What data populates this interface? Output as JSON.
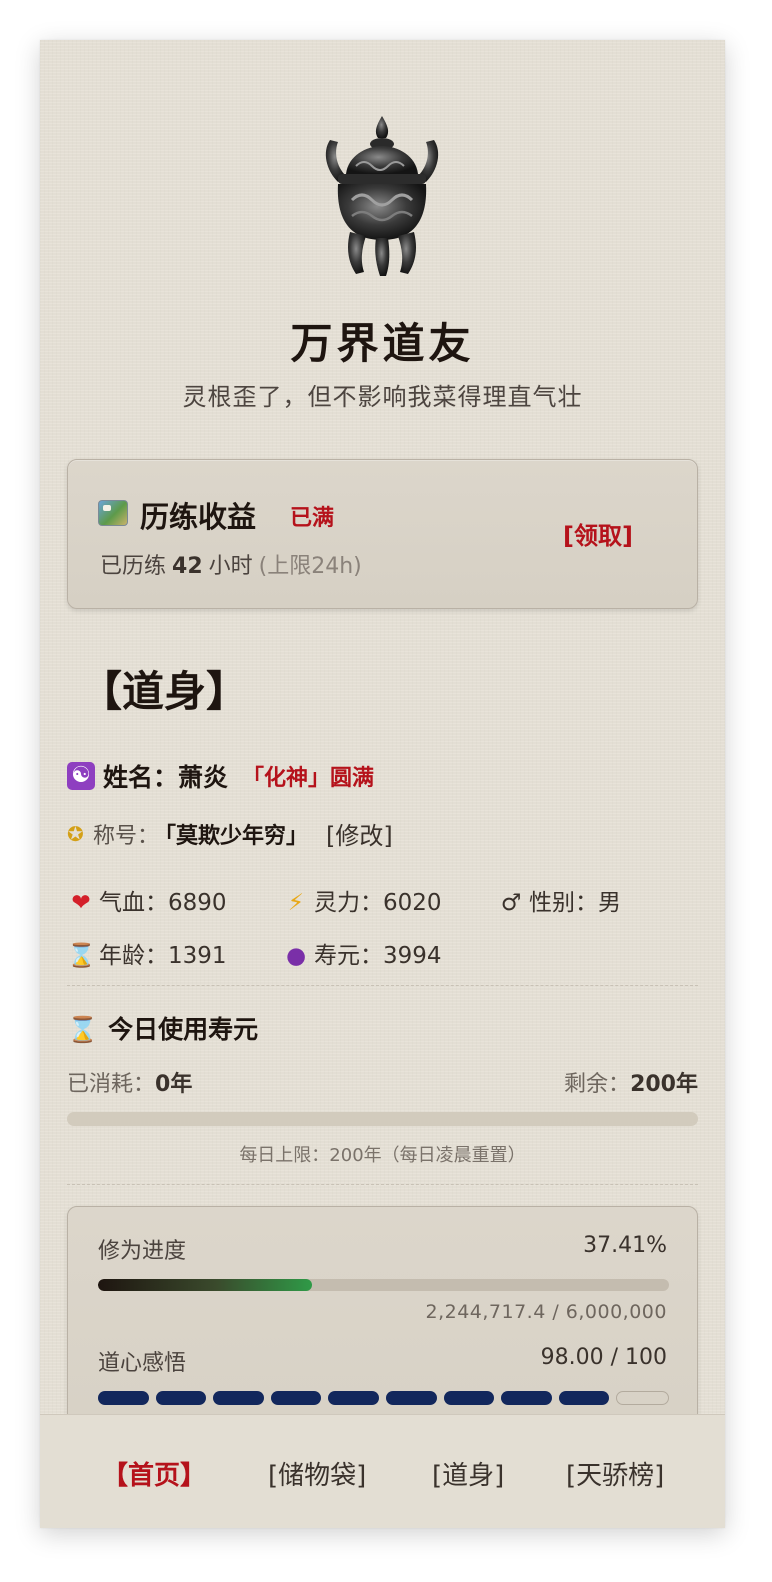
{
  "header": {
    "title": "万界道友",
    "subtitle": "灵根歪了，但不影响我菜得理直气壮"
  },
  "training": {
    "title": "历练收益",
    "status": "已满",
    "hours_prefix": "已历练",
    "hours": "42",
    "hours_unit": "小时",
    "cap": "(上限24h)",
    "claim_label": "[领取]"
  },
  "section_title": "【道身】",
  "profile": {
    "name_label": "姓名：萧炎",
    "realm": "「化神」圆满",
    "title_label": "称号：",
    "title_value": "「莫欺少年穷」",
    "title_edit": "[修改]"
  },
  "stats": {
    "hp": "气血：6890",
    "mp": "灵力：6020",
    "gender": "性别：男",
    "age": "年龄：1391",
    "lifespan": "寿元：3994"
  },
  "life_today": {
    "title": "今日使用寿元",
    "used_label": "已消耗：",
    "used": "0年",
    "left_label": "剩余：",
    "left": "200年",
    "used_fraction": 0,
    "note": "每日上限：200年（每日凌晨重置）"
  },
  "progress": {
    "cultivation_label": "修为进度",
    "cultivation_pct": "37.41%",
    "cultivation_fraction": 0.3741,
    "cultivation_numbers": "2,244,717.4 / 6,000,000",
    "insight_label": "道心感悟",
    "insight_value": "98.00 / 100",
    "insight_segments_filled": 9,
    "insight_segments_total": 10
  },
  "nav": {
    "home": "【首页】",
    "bag": "[储物袋]",
    "body": "[道身]",
    "rank": "[天骄榜]"
  },
  "icons": {
    "logo": "incense-burner-icon",
    "training": "map-icon",
    "name": "yin-yang-icon",
    "title": "medal-icon",
    "hp": "heart-icon",
    "mp": "lightning-icon",
    "gender": "male-icon",
    "age": "hourglass-icon",
    "lifespan": "crystal-ball-icon"
  },
  "colors": {
    "accent_red": "#b5121b",
    "insight_blue": "#12275c",
    "progress_green": "#2f9a47",
    "background": "#e6e1d6"
  }
}
